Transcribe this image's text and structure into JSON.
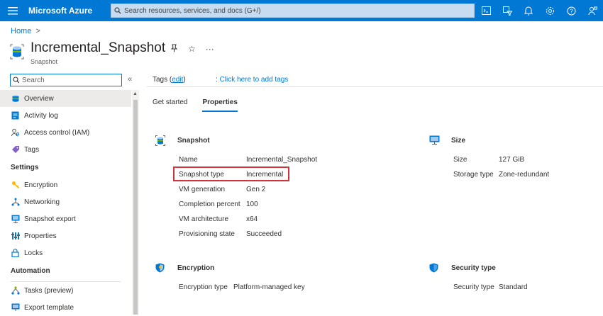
{
  "topbar": {
    "brand": "Microsoft Azure",
    "search_placeholder": "Search resources, services, and docs (G+/)",
    "icons": [
      "cloud-shell-icon",
      "directory-filter-icon",
      "notifications-icon",
      "settings-icon",
      "help-icon",
      "feedback-icon"
    ]
  },
  "breadcrumb": {
    "home": "Home",
    "separator": ">"
  },
  "resource": {
    "title": "Incremental_Snapshot",
    "subtitle": "Snapshot",
    "pin": "⚲",
    "star": "☆",
    "more": "···"
  },
  "sidebar": {
    "search_placeholder": "Search",
    "collapse": "«",
    "items": [
      {
        "label": "Overview",
        "icon": "overview-icon"
      },
      {
        "label": "Activity log",
        "icon": "activity-log-icon"
      },
      {
        "label": "Access control (IAM)",
        "icon": "iam-icon"
      },
      {
        "label": "Tags",
        "icon": "tag-icon"
      }
    ],
    "settings_header": "Settings",
    "settings_items": [
      {
        "label": "Encryption",
        "icon": "key-icon"
      },
      {
        "label": "Networking",
        "icon": "networking-icon"
      },
      {
        "label": "Snapshot export",
        "icon": "export-icon"
      },
      {
        "label": "Properties",
        "icon": "properties-icon"
      },
      {
        "label": "Locks",
        "icon": "lock-icon"
      }
    ],
    "automation_header": "Automation",
    "automation_items": [
      {
        "label": "Tasks (preview)",
        "icon": "tasks-icon"
      },
      {
        "label": "Export template",
        "icon": "template-icon"
      }
    ]
  },
  "tags": {
    "label": "Tags (",
    "edit": "edit",
    "close": ")",
    "colon": ":",
    "add": "Click here to add tags"
  },
  "tabs": [
    "Get started",
    "Properties"
  ],
  "snapshot_section": {
    "title": "Snapshot",
    "rows": [
      {
        "label": "Name",
        "value": "Incremental_Snapshot"
      },
      {
        "label": "Snapshot type",
        "value": "Incremental"
      },
      {
        "label": "VM generation",
        "value": "Gen 2"
      },
      {
        "label": "Completion percent",
        "value": "100"
      },
      {
        "label": "VM architecture",
        "value": "x64"
      },
      {
        "label": "Provisioning state",
        "value": "Succeeded"
      }
    ]
  },
  "size_section": {
    "title": "Size",
    "rows": [
      {
        "label": "Size",
        "value": "127 GiB"
      },
      {
        "label": "Storage type",
        "value": "Zone-redundant"
      }
    ]
  },
  "encryption_section": {
    "title": "Encryption",
    "rows": [
      {
        "label": "Encryption type",
        "value": "Platform-managed key"
      }
    ]
  },
  "security_section": {
    "title": "Security type",
    "rows": [
      {
        "label": "Security type",
        "value": "Standard"
      }
    ]
  },
  "colors": {
    "accent": "#0078d4",
    "highlight": "#d13438"
  }
}
